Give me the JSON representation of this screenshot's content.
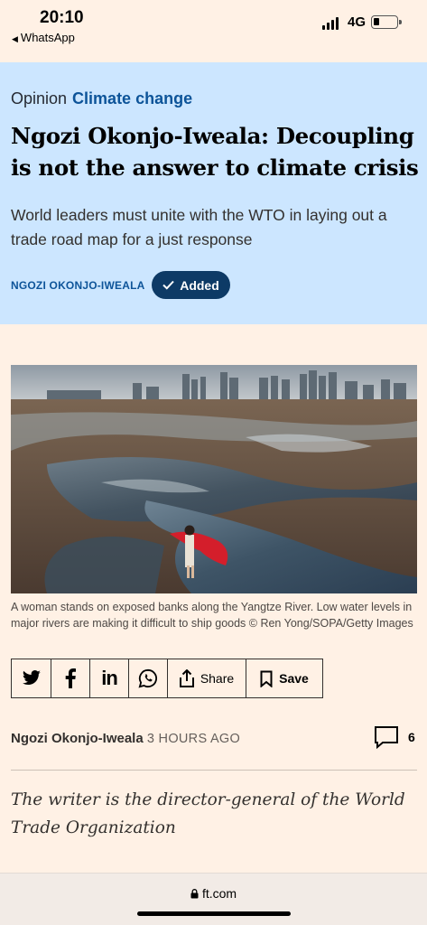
{
  "status_bar": {
    "time": "20:10",
    "back_app": "WhatsApp",
    "network": "4G",
    "battery_level": 0.2
  },
  "article": {
    "kicker": "Opinion",
    "topic": "Climate change",
    "headline": "Ngozi Okonjo-Iweala: Decoupling is not the answer to climate crisis",
    "standfirst": "World leaders must unite with the WTO in laying out a trade road map for a just response",
    "author_tag": "NGOZI OKONJO-IWEALA",
    "follow_label": "Added",
    "image_caption": "A woman stands on exposed banks along the Yangtze River. Low water levels in major rivers are making it difficult to ship goods © Ren Yong/SOPA/Getty Images",
    "byline_name": "Ngozi Okonjo-Iweala",
    "byline_time": "3 HOURS AGO",
    "comment_count": "6",
    "writer_note": "The writer is the director-general of the World Trade Organization"
  },
  "share": {
    "icons": [
      "twitter-icon",
      "facebook-icon",
      "linkedin-icon",
      "whatsapp-icon"
    ],
    "share_label": "Share",
    "save_label": "Save"
  },
  "browser": {
    "url": "ft.com"
  },
  "colors": {
    "background": "#fff1e5",
    "hero_background": "#cce6ff",
    "accent_blue": "#0d5499",
    "button_blue": "#0d3a66"
  }
}
